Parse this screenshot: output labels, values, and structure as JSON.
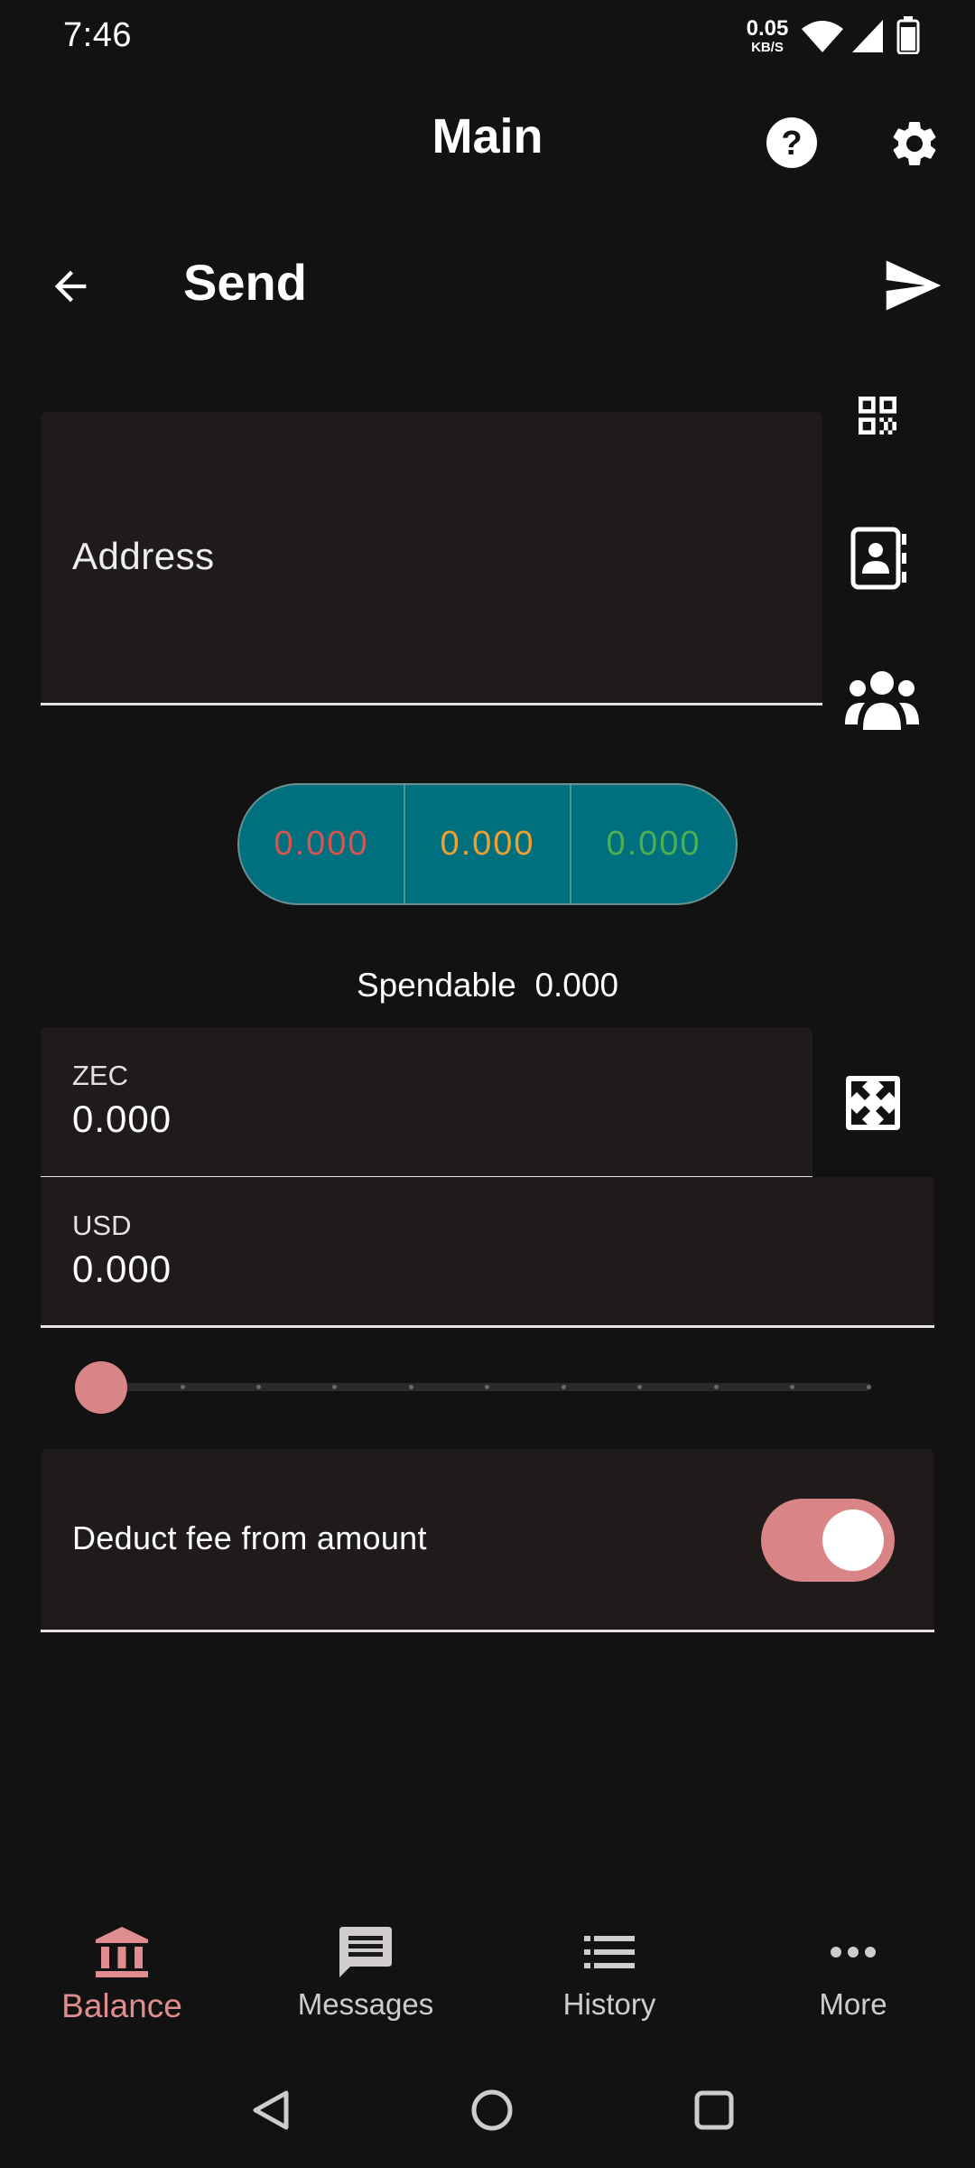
{
  "status_bar": {
    "time": "7:46",
    "net_speed": "0.05",
    "net_unit": "KB/S"
  },
  "app_bar": {
    "title": "Main",
    "help_icon": "help-circle-icon",
    "settings_icon": "gear-icon"
  },
  "page": {
    "title": "Send",
    "back_icon": "arrow-left-icon",
    "send_icon": "send-icon"
  },
  "address_field": {
    "label": "Address",
    "value": "",
    "side_icons": [
      "qr-code-icon",
      "contact-book-icon",
      "group-icon"
    ]
  },
  "pools": {
    "transparent": "0.000",
    "sapling": "0.000",
    "orchard": "0.000",
    "colors": {
      "transparent": "#d9534f",
      "sapling": "#f0a030",
      "orchard": "#4caf50",
      "pill_bg": "#00707f"
    }
  },
  "spendable": {
    "label": "Spendable",
    "value": "0.000"
  },
  "amount": {
    "zec_label": "ZEC",
    "zec_value": "0.000",
    "usd_label": "USD",
    "usd_value": "0.000",
    "max_icon": "expand-arrows-icon"
  },
  "slider": {
    "value_fraction": 0,
    "ticks": 11
  },
  "deduct_fee": {
    "label": "Deduct fee from amount",
    "enabled": true
  },
  "bottom_nav": {
    "items": [
      {
        "label": "Balance",
        "icon": "bank-icon",
        "active": true
      },
      {
        "label": "Messages",
        "icon": "message-icon",
        "active": false
      },
      {
        "label": "History",
        "icon": "list-icon",
        "active": false
      },
      {
        "label": "More",
        "icon": "more-horizontal-icon",
        "active": false
      }
    ]
  },
  "system_nav": [
    "back-triangle-icon",
    "home-circle-icon",
    "recents-square-icon"
  ],
  "accent_color": "#d98486"
}
